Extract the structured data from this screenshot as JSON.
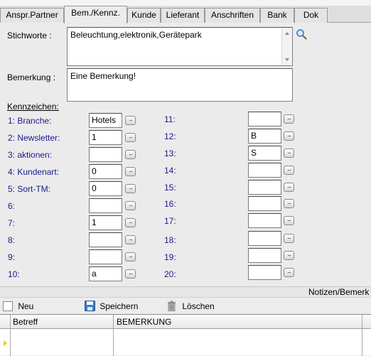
{
  "tabs": [
    {
      "label": "Anspr.Partner"
    },
    {
      "label": "Bem./Kennz."
    },
    {
      "label": "Kunde"
    },
    {
      "label": "Lieferant"
    },
    {
      "label": "Anschriften"
    },
    {
      "label": "Bank"
    },
    {
      "label": "Dok"
    }
  ],
  "active_tab": "Bem./Kennz.",
  "stichworte": {
    "label": "Stichworte :",
    "value": "Beleuchtung,elektronik,Gerätepark"
  },
  "bemerkung": {
    "label": "Bemerkung :",
    "value": "Eine Bemerkung!"
  },
  "kennzeichen": {
    "heading": "Kennzeichen:",
    "button_label": "...",
    "left": [
      {
        "label": "1: Branche:",
        "value": "Hotels"
      },
      {
        "label": "2: Newsletter:",
        "value": "1"
      },
      {
        "label": "3: aktionen:",
        "value": ""
      },
      {
        "label": "4: Kundenart:",
        "value": "0"
      },
      {
        "label": "5: Sort-TM:",
        "value": "0"
      },
      {
        "label": "6:",
        "value": ""
      },
      {
        "label": "7:",
        "value": "1"
      },
      {
        "label": "8:",
        "value": ""
      },
      {
        "label": "9:",
        "value": ""
      },
      {
        "label": "10:",
        "value": "a"
      }
    ],
    "right": [
      {
        "label": "11:",
        "value": ""
      },
      {
        "label": "12:",
        "value": "B"
      },
      {
        "label": "13:",
        "value": "S"
      },
      {
        "label": "14:",
        "value": ""
      },
      {
        "label": "15:",
        "value": ""
      },
      {
        "label": "16:",
        "value": ""
      },
      {
        "label": "17:",
        "value": ""
      },
      {
        "label": "18:",
        "value": ""
      },
      {
        "label": "19:",
        "value": ""
      },
      {
        "label": "20:",
        "value": ""
      }
    ]
  },
  "notizen_label": "Notizen/Bemerk",
  "toolbar": {
    "new": "Neu",
    "save": "Speichern",
    "delete": "Löschen"
  },
  "grid": {
    "columns": [
      "Betreff",
      "BEMERKUNG"
    ]
  },
  "colors": {
    "kennzeichen_label": "#1a1a8c",
    "row_indicator": "#e8d000",
    "search_icon": "#2f78c8"
  }
}
